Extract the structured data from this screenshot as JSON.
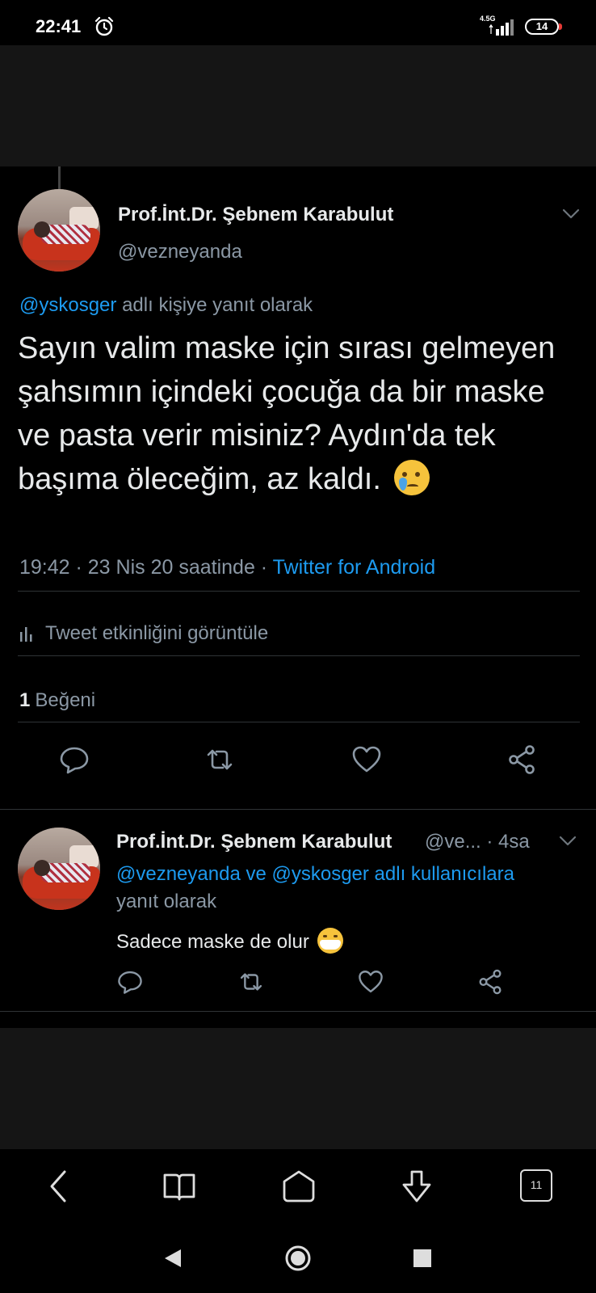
{
  "status_bar": {
    "time": "22:41",
    "network": "4.5G",
    "battery": "14",
    "icons": [
      "alarm-icon",
      "signal-icon",
      "battery-icon"
    ]
  },
  "main_tweet": {
    "author_name": "Prof.İnt.Dr. Şebnem Karabulut",
    "author_handle": "@vezneyanda",
    "replying_to_handle": "@yskosger",
    "replying_to_suffix": " adlı kişiye yanıt olarak",
    "text": "Sayın valim maske için sırası gelmeyen şahsımın içindeki çocuğa da bir maske ve pasta verir misiniz? Aydın'da tek başıma öleceğim, az kaldı.",
    "emoji": "crying-face-emoji",
    "time": "19:42",
    "date_text": " · 23 Nis 20 saatinde · ",
    "source": "Twitter for Android",
    "activity_label": "Tweet etkinliğini görüntüle",
    "likes_count": "1",
    "likes_label": "Beğeni"
  },
  "reply_tweet": {
    "author_name": "Prof.İnt.Dr. Şebnem Karabulut",
    "author_handle_truncated": "@ve...",
    "age": " · 4sa",
    "replying_to_links": "@vezneyanda ve @yskosger adlı kullanıcılara",
    "replying_to_tail": "yanıt olarak",
    "text": "Sadece maske de olur",
    "emoji": "face-with-mask-emoji"
  },
  "browser_nav": {
    "tabs_count": "11",
    "icons": [
      "back-icon",
      "bookmarks-icon",
      "home-icon",
      "download-icon",
      "tabs-icon"
    ]
  },
  "system_nav": {
    "icons": [
      "system-back-icon",
      "system-home-icon",
      "system-recents-icon"
    ]
  },
  "colors": {
    "background": "#000000",
    "panel": "#151515",
    "link": "#1d9bf0",
    "secondary_text": "#8b98a5",
    "primary_text": "#e7e9ea"
  }
}
